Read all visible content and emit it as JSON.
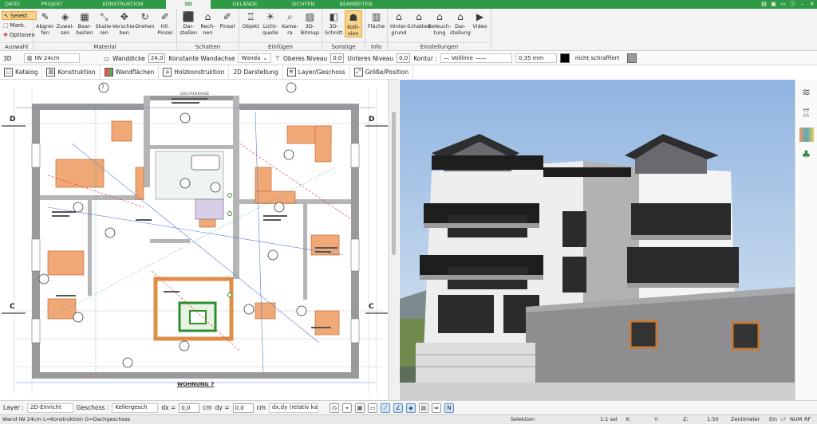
{
  "tabs": [
    "DATEI",
    "PROJEKT",
    "KONSTRUKTION",
    "3D",
    "GELÄNDE",
    "SICHTEN",
    "BEARBEITEN"
  ],
  "ribbon": {
    "auswahl": {
      "label": "Auswahl",
      "items": [
        "Selekt",
        "Mark.",
        "Optionen"
      ]
    },
    "material": {
      "label": "Material",
      "buttons": [
        "Abgrei-\nfen",
        "Zuwei-\nsen",
        "Bear-\nbeiten",
        "Skalie-\nren",
        "Verschie-\nben",
        "Drehen",
        "Hil.\nPinsel"
      ]
    },
    "schatten": {
      "label": "Schatten",
      "buttons": [
        "Dar-\nstellen",
        "Rech-\nnen",
        "Pinsel"
      ]
    },
    "einfuegen": {
      "label": "Einfügen",
      "buttons": [
        "Objekt",
        "Licht-\nquelle",
        "Kame-\nra",
        "3D-\nBitmap"
      ]
    },
    "sonstige": {
      "label": "Sonstige",
      "buttons": [
        "3D-\nSchnitt",
        "Kolli-\nsion"
      ]
    },
    "info": {
      "label": "Info",
      "buttons": [
        "Fläche"
      ]
    },
    "einstellungen": {
      "label": "Einstellungen",
      "buttons": [
        "Hinter-\ngrund",
        "Schatten",
        "Beleuch-\ntung",
        "Dar-\nstellung",
        "Video"
      ]
    }
  },
  "propbar": {
    "mode": "3D",
    "wall_type": "IW 24cm",
    "wanddicke_label": "Wanddicke",
    "wanddicke": "24,0",
    "wandachse_label": "Konstante Wandachse",
    "wandachse_value": "Wanda",
    "oberes_label": "Oberes Niveau",
    "oberes": "0,0",
    "unteres_label": "Unteres Niveau",
    "unteres": "0,0",
    "kontur_label": "Kontur :",
    "linestyle": "Volllinie",
    "width_label": "0,35 mm",
    "fill": "nicht schraffiert"
  },
  "toolbar2": [
    "Katalog",
    "Konstruktion",
    "Wandflächen",
    "Holzkonstruktion",
    "2D Darstellung",
    "Layer/Geschoss",
    "Größe/Position"
  ],
  "plan": {
    "title": "WOHNUNG 7",
    "grid_left_top": "D",
    "grid_left_bottom": "C",
    "grid_right_top": "D",
    "grid_right_bottom": "C",
    "room_marker": "7",
    "terrace": "DACHTERRASSE"
  },
  "bottombar": {
    "layer_label": "Layer :",
    "layer_value": "2D-Einricht",
    "geschoss_label": "Geschoss :",
    "geschoss_value": "Kellergesch",
    "dx_label": "dx =",
    "dx": "0,0",
    "dx_unit": "cm",
    "dy_label": "dy =",
    "dy": "0,0",
    "dy_unit": "cm",
    "rel_label": "dx,dy (relativ ka"
  },
  "status": {
    "left": "Wand IW 24cm L=Konstruktion G=Dachgeschoss",
    "mode": "Selektion",
    "sel": "1:1 sel",
    "x": "X:",
    "y": "Y:",
    "z": "Z:",
    "scale": "1:50",
    "unit": "Zentimeter",
    "ein": "Ein",
    "uf": "UF",
    "num": "NUM",
    "rf": "RF"
  },
  "colors": {
    "accent": "#2f9a45",
    "highlight": "#f6d28a",
    "plan_orange": "#f0a877",
    "sky_top": "#8fb4e1"
  }
}
